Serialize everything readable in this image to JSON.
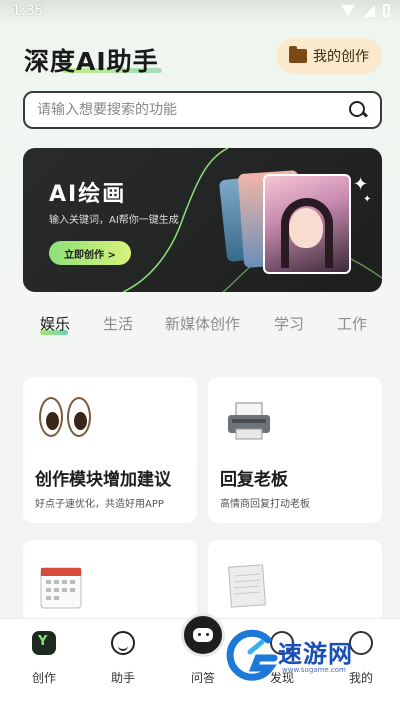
{
  "status": {
    "time": "1:35"
  },
  "header": {
    "title": "深度AI助手",
    "my_work_label": "我的创作"
  },
  "search": {
    "placeholder": "请输入想要搜索的功能"
  },
  "banner": {
    "title": "AI绘画",
    "subtitle": "输入关键词，AI帮你一键生成",
    "button_label": "立即创作 >"
  },
  "tabs": [
    {
      "label": "娱乐",
      "active": true
    },
    {
      "label": "生活",
      "active": false
    },
    {
      "label": "新媒体创作",
      "active": false
    },
    {
      "label": "学习",
      "active": false
    },
    {
      "label": "工作",
      "active": false
    }
  ],
  "cards": [
    {
      "title": "创作模块增加建议",
      "desc": "好点子速优化，共造好用APP",
      "icon": "eyes-icon"
    },
    {
      "title": "回复老板",
      "desc": "高情商回复打动老板",
      "icon": "printer-icon"
    },
    {
      "title": "",
      "desc": "",
      "icon": "calendar-icon"
    },
    {
      "title": "",
      "desc": "",
      "icon": "paper-icon"
    }
  ],
  "bottom_nav": [
    {
      "label": "创作",
      "icon": "create-icon"
    },
    {
      "label": "助手",
      "icon": "helper-icon"
    },
    {
      "label": "问答",
      "icon": "robot-icon"
    },
    {
      "label": "发现",
      "icon": "discover-icon"
    },
    {
      "label": "我的",
      "icon": "me-icon"
    }
  ],
  "watermark": {
    "text": "速游网",
    "sub": "www.sugame.com"
  },
  "colors": {
    "accent_green": "#8ee07a",
    "dark": "#1e1e1e",
    "my_work_bg": "#fbe9cd"
  }
}
